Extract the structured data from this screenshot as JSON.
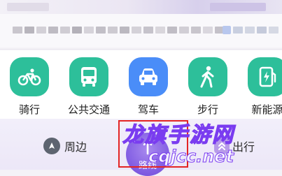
{
  "shortcuts": [
    {
      "label": "骑行",
      "icon": "bicycle-icon",
      "color": "#2dbf9a"
    },
    {
      "label": "公共交通",
      "icon": "bus-icon",
      "color": "#2dbf9a"
    },
    {
      "label": "驾车",
      "icon": "car-icon",
      "color": "#4a8df8"
    },
    {
      "label": "步行",
      "icon": "walk-icon",
      "color": "#2dbf9a"
    },
    {
      "label": "新能源",
      "icon": "ev-charging-icon",
      "color": "#2dbf9a"
    }
  ],
  "bottom_bar": {
    "nearby_label": "周边",
    "route_label": "路线",
    "travel_label": "出行"
  },
  "watermark": {
    "main": "龙旗手游网",
    "url": "cqjcc.net"
  },
  "colors": {
    "accent_purple": "#8561e4",
    "teal": "#2dbf9a",
    "blue": "#4a8df8",
    "highlight_red": "#e32424"
  }
}
